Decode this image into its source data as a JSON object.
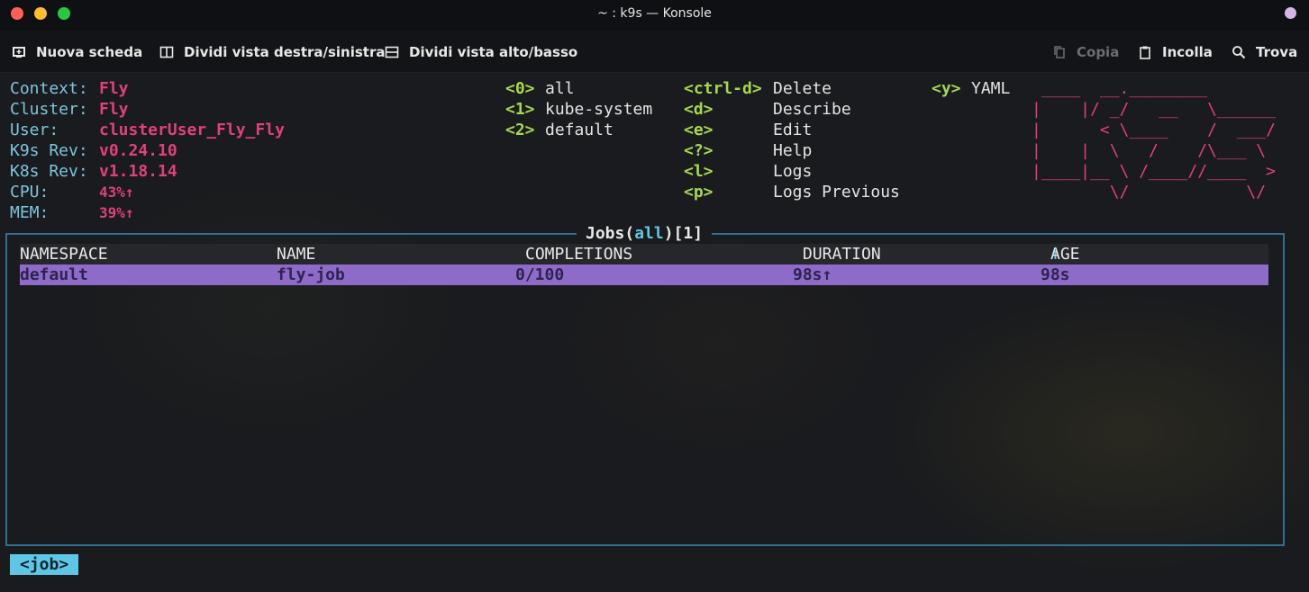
{
  "window": {
    "title": "~ : k9s — Konsole"
  },
  "toolbar": {
    "new_tab": "Nuova scheda",
    "split_lr": "Dividi vista destra/sinistra",
    "split_tb": "Dividi vista alto/basso",
    "copy": "Copia",
    "paste": "Incolla",
    "find": "Trova"
  },
  "info": {
    "context_label": "Context:",
    "context": "Fly",
    "cluster_label": "Cluster:",
    "cluster": "Fly",
    "user_label": "User:",
    "user": "clusterUser_Fly_Fly",
    "k9s_rev_label": "K9s Rev:",
    "k9s_rev": "v0.24.10",
    "k8s_rev_label": "K8s Rev:",
    "k8s_rev": "v1.18.14",
    "cpu_label": "CPU:",
    "cpu": "43%↑",
    "mem_label": "MEM:",
    "mem": "39%↑"
  },
  "namespaces": [
    {
      "key": "<0>",
      "name": "all"
    },
    {
      "key": "<1>",
      "name": "kube-system"
    },
    {
      "key": "<2>",
      "name": "default"
    }
  ],
  "shortcuts": [
    {
      "key": "<ctrl-d>",
      "action": "Delete"
    },
    {
      "key": "<d>",
      "action": "Describe"
    },
    {
      "key": "<e>",
      "action": "Edit"
    },
    {
      "key": "<?>",
      "action": "Help"
    },
    {
      "key": "<l>",
      "action": "Logs"
    },
    {
      "key": "<p>",
      "action": "Logs Previous"
    }
  ],
  "extra_shortcut": {
    "key": "<y>",
    "action": "YAML"
  },
  "logo": {
    "lines": [
      " ____  __.________        ",
      "|    |/ _/   __   \\______ ",
      "|      < \\____    /  ___/ ",
      "|    |  \\   /    /\\___ \\  ",
      "|____|__ \\ /____//____  > ",
      "        \\/            \\/  "
    ]
  },
  "panel": {
    "title_prefix": "Jobs(",
    "title_filter": "all",
    "title_mid": ")[",
    "title_count": "1",
    "title_suffix": "]"
  },
  "table": {
    "headers": [
      "NAMESPACE",
      "NAME",
      "COMPLETIONS",
      "DURATION",
      "AGE"
    ],
    "sort_indicator": "↑",
    "rows": [
      {
        "namespace": "default",
        "name": "fly-job",
        "completions": "0/100",
        "duration": "98s↑",
        "age": "98s"
      }
    ]
  },
  "breadcrumb": "<job>"
}
